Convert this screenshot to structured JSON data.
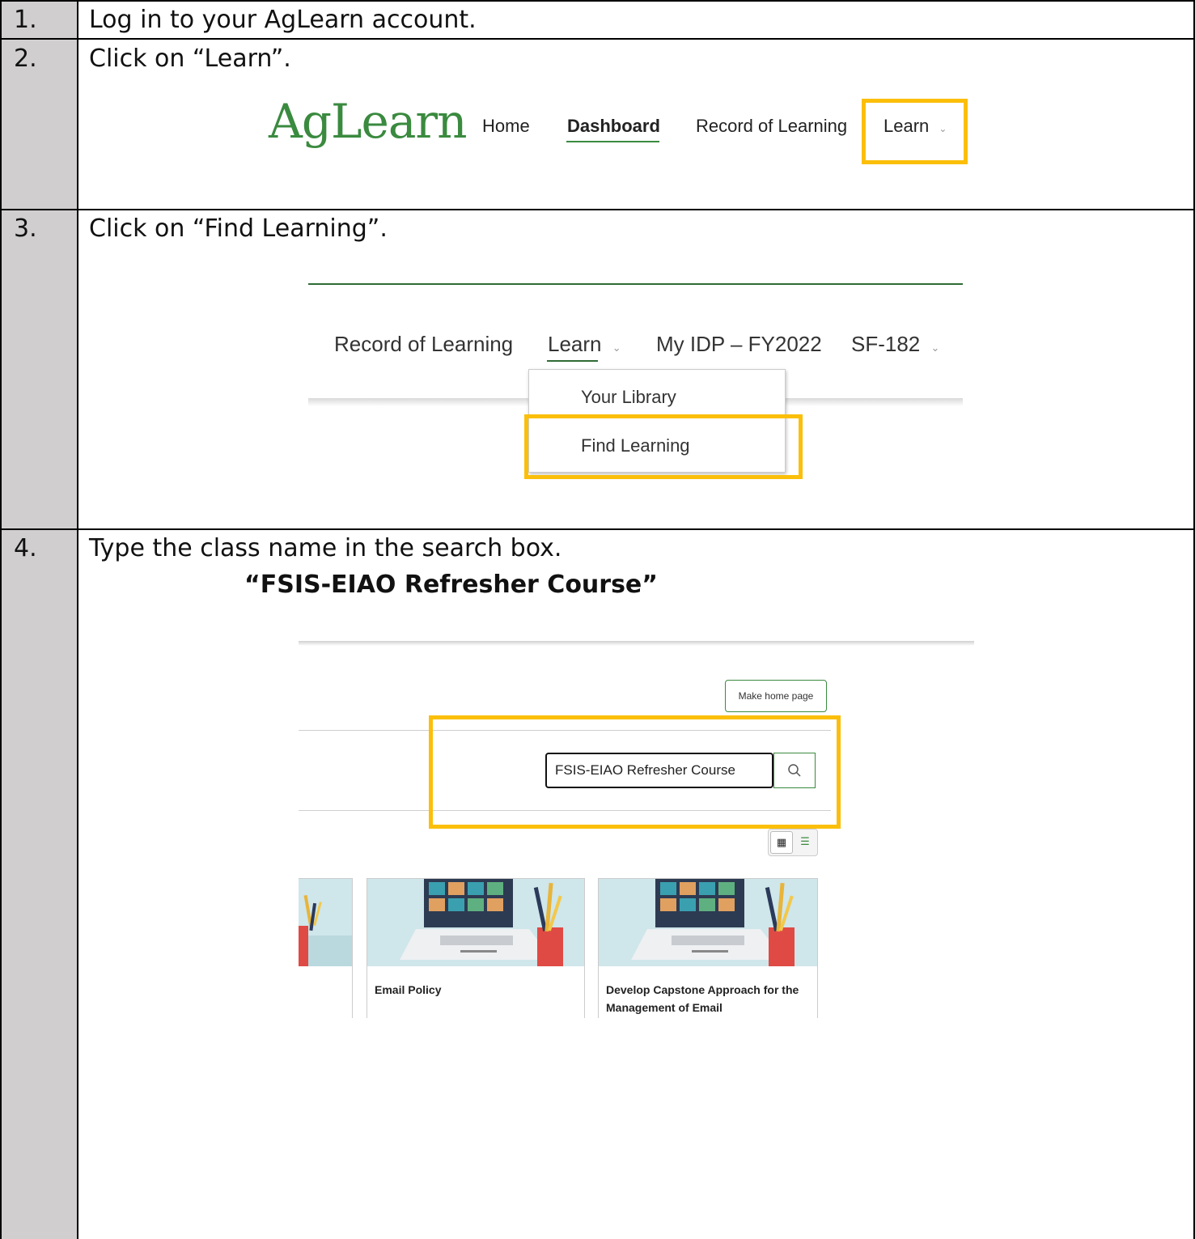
{
  "steps": [
    {
      "num": "1.",
      "text": "Log in to your AgLearn account."
    },
    {
      "num": "2.",
      "text": "Click on “Learn”."
    },
    {
      "num": "3.",
      "text": "Click on “Find Learning”."
    },
    {
      "num": "4.",
      "text": "Type the class name in the search box."
    }
  ],
  "class_name": "“FSIS-EIAO Refresher Course”",
  "shot1": {
    "logo": "AgLearn",
    "nav": [
      "Home",
      "Dashboard",
      "Record of Learning",
      "Learn"
    ]
  },
  "shot2": {
    "nav": [
      "Record of Learning",
      "Learn",
      "My IDP – FY2022",
      "SF-182"
    ],
    "dropdown": [
      "Your Library",
      "Find Learning"
    ]
  },
  "shot3": {
    "make_home": "Make home page",
    "search_value": "FSIS-EIAO Refresher Course",
    "cards": [
      "Email Policy",
      "Develop Capstone Approach for the Management of Email"
    ]
  },
  "colors": {
    "highlight": "#fbbf0a",
    "brand_green": "#3a8a3f",
    "number_column": "#d0cece"
  }
}
